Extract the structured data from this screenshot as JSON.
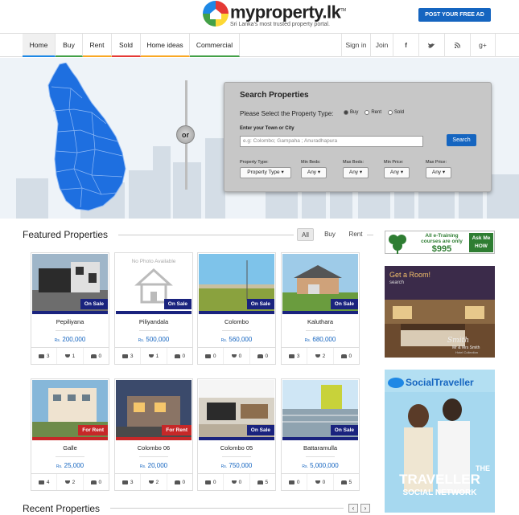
{
  "brand": {
    "name": "myproperty.lk",
    "tm": "TM",
    "tagline": "Sri Lanka's most trusted property portal.",
    "post_ad": "POST YOUR FREE AD"
  },
  "nav": {
    "items": [
      "Home",
      "Buy",
      "Rent",
      "Sold",
      "Home ideas",
      "Commercial"
    ],
    "right": {
      "signin": "Sign in",
      "join": "Join",
      "social": [
        "f",
        "t",
        "rss",
        "g+"
      ]
    }
  },
  "search": {
    "title": "Search Properties",
    "select_label": "Please Select the Property Type:",
    "types": [
      "Buy",
      "Rent",
      "Sold"
    ],
    "selected_type": "Buy",
    "town_label": "Enter your Town or City",
    "town_placeholder": "e.g: Colombo; Gampaha ; Anuradhapura",
    "button": "Search",
    "filters": [
      {
        "label": "Property Type:",
        "value": "Property Type"
      },
      {
        "label": "Min Beds:",
        "value": "Any"
      },
      {
        "label": "Max Beds:",
        "value": "Any"
      },
      {
        "label": "Min Price:",
        "value": "Any"
      },
      {
        "label": "Max Price:",
        "value": "Any"
      }
    ],
    "or_label": "or"
  },
  "featured": {
    "title": "Featured Properties",
    "tabs": [
      "All",
      "Buy",
      "Rent"
    ],
    "active_tab": "All",
    "no_photo": "No Photo Available",
    "currency": "Rs.",
    "cards": [
      {
        "name": "Pepiliyana",
        "price": "200,000",
        "badge": "On Sale",
        "beds": "3",
        "baths": "1",
        "cars": "0",
        "img": "house1"
      },
      {
        "name": "Piliyandala",
        "price": "500,000",
        "badge": "On Sale",
        "beds": "3",
        "baths": "1",
        "cars": "0",
        "img": "nophoto"
      },
      {
        "name": "Colombo",
        "price": "560,000",
        "badge": "On Sale",
        "beds": "0",
        "baths": "0",
        "cars": "0",
        "img": "land"
      },
      {
        "name": "Kaluthara",
        "price": "680,000",
        "badge": "On Sale",
        "beds": "3",
        "baths": "2",
        "cars": "0",
        "img": "house2"
      },
      {
        "name": "Galle",
        "price": "25,000",
        "badge": "For Rent",
        "beds": "4",
        "baths": "2",
        "cars": "0",
        "img": "apartment"
      },
      {
        "name": "Colombo 06",
        "price": "20,000",
        "badge": "For Rent",
        "beds": "3",
        "baths": "2",
        "cars": "0",
        "img": "night"
      },
      {
        "name": "Colombo 05",
        "price": "750,000",
        "badge": "On Sale",
        "beds": "0",
        "baths": "0",
        "cars": "5",
        "img": "interior"
      },
      {
        "name": "Battaramulla",
        "price": "5,000,000",
        "badge": "On Sale",
        "beds": "0",
        "baths": "0",
        "cars": "5",
        "img": "balcony"
      }
    ]
  },
  "recent": {
    "title": "Recent Properties",
    "prev": "‹",
    "next": "›"
  },
  "ads": {
    "ad1": {
      "line1": "All e-Training",
      "line2": "courses are only",
      "price": "$995",
      "cta_top": "Ask Me",
      "cta_bottom": "HOW"
    },
    "ad2": {
      "title": "Get a Room!",
      "sub": "search",
      "brand": "Mr & Mrs Smith",
      "sign": "Smith",
      "sub2": "Hotel Collection"
    },
    "ad3": {
      "brand": "SocialTraveller",
      "the": "THE",
      "main": "TRAVELLER",
      "sub": "SOCIAL NETWORK"
    }
  }
}
